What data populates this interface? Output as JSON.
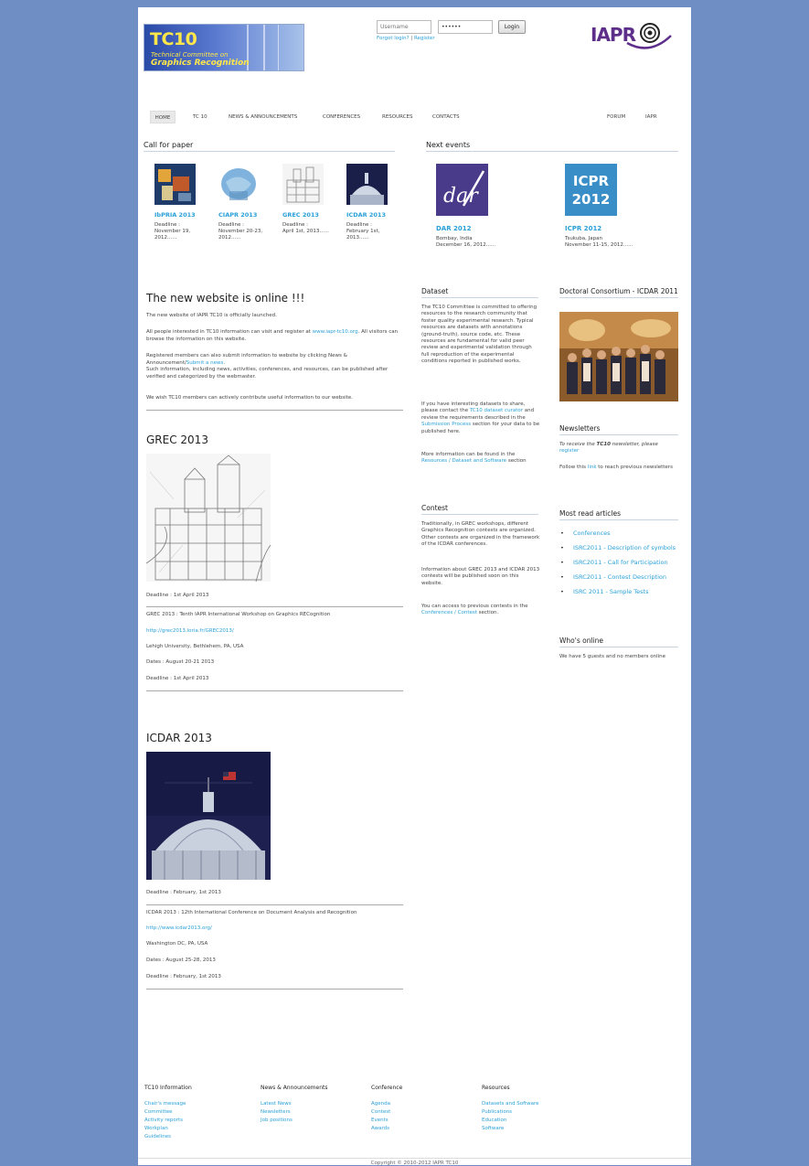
{
  "header": {
    "logo_big": "TC10",
    "logo_small1": "Technical Committee on",
    "logo_small2": "Graphics Recognition",
    "username_placeholder": "Username",
    "password_value": "••••••",
    "login_label": "Login",
    "forgot_label": "Forgot login?",
    "sep": "|",
    "register_label": "Register",
    "iapr_label": "IAPR"
  },
  "nav": {
    "items": [
      "HOME",
      "TC 10",
      "NEWS & ANNOUNCEMENTS",
      "CONFERENCES",
      "RESOURCES",
      "CONTACTS"
    ],
    "right": [
      "FORUM",
      "IAPR"
    ]
  },
  "call_for_paper": {
    "heading": "Call for paper",
    "items": [
      {
        "title": "IbPRIA 2013",
        "deadline": "Deadline :\nNovember 19,\n2012......"
      },
      {
        "title": "CIAPR 2013",
        "deadline": "Deadline :\nNovember 20-23,\n2012......"
      },
      {
        "title": "GREC 2013",
        "deadline": "Deadline :\nApril 1st, 2013......"
      },
      {
        "title": "ICDAR 2013",
        "deadline": "Deadline :\nFebruary 1st,\n2013......"
      }
    ]
  },
  "next_events": {
    "heading": "Next events",
    "items": [
      {
        "logo_text": "dar",
        "title": "DAR 2012",
        "loc": "Bombay, India",
        "date": "December 16, 2012......"
      },
      {
        "logo_text1": "ICPR",
        "logo_text2": "2012",
        "title": "ICPR 2012",
        "loc": "Tsukuba, Japan",
        "date": "November 11-15, 2012......"
      }
    ]
  },
  "main": {
    "news_title": "The new website is online !!!",
    "news_p1": "The new website of IAPR TC10 is officially launched.",
    "news_p2a": "All people interested in TC10 information can visit and register at ",
    "news_p2_link": "www.iapr-tc10.org",
    "news_p2b": ". All visitors can browse the information on this website.",
    "news_p3a": "Registered members can also submit information to website by clicking News & Announcement/",
    "news_p3_link": "Submit a news",
    "news_p3b": ".",
    "news_p4": "Such information, including news, activities, conferences, and resources,  can be published after verified and categorized by the webmaster.",
    "news_p5": "We wish TC10 members can actively contribute useful information to our website.",
    "grec_title": "GREC 2013",
    "grec_deadline": "Deadline : 1st April 2013",
    "grec_desc": "GREC 2013 : Tenth IAPR International Workshop on Graphics RECognition",
    "grec_url": "http://grec2013.loria.fr/GREC2013/",
    "grec_loc": "Lehigh University, Bethlehem, PA, USA",
    "grec_dates": "Dates : August 20-21 2013",
    "grec_deadline2": "Deadline : 1st April 2013",
    "icdar_title": "ICDAR 2013",
    "icdar_deadline": "Deadline : February, 1st 2013",
    "icdar_desc": "ICDAR 2013 : 12th International Conference on Document Analysis and Recognition",
    "icdar_url": "http://www.icdar2013.org/",
    "icdar_loc": "Washington DC, PA, USA",
    "icdar_dates": "Dates : August 25-28, 2013",
    "icdar_deadline2": "Deadline : February, 1st 2013"
  },
  "dataset": {
    "heading": "Dataset",
    "p1": "The TC10 Committee is committed to offering resources to the research community that foster quality experimental research. Typical resources are datasets with annotations (ground-truth), source code, etc. These resources are fundamental for valid peer review and experimental validation through full reproduction of the experimental conditions reported in published works.",
    "p2a": "If you have interesting datasets to share, please contact the ",
    "p2_link1": "TC10 dataset curator",
    "p2b": " and review the requirements described in the ",
    "p2_link2": "Submission Process",
    "p2c": " section for your data to be published here.",
    "p3a": "More information can be found in the ",
    "p3_link": "Resources / Dataset and Software",
    "p3b": " section"
  },
  "contest": {
    "heading": "Contest",
    "p1": "Traditionally, in GREC workshops, different Graphics Recognition contests are organized. Other contests are organized in the framework of the ICDAR conferences.",
    "p2": "Information about GREC 2013 and ICDAR 2013 contests will be published soon on this website.",
    "p3a": "You can access to previous contests in the ",
    "p3_link": "Conferences / Contest",
    "p3b": "  section."
  },
  "right": {
    "dc_heading": "Doctoral Consortium - ICDAR 2011",
    "newsletters_heading": "Newsletters",
    "nl_p1a": "To receive the ",
    "nl_p1b": "TC10",
    "nl_p1c": " newsletter, please ",
    "nl_p1_link": "register",
    "nl_p2a": "Follow this ",
    "nl_p2_link": "link",
    "nl_p2b": " to reach previous newsletters",
    "mra_heading": "Most read articles",
    "mra_items": [
      "Conferences",
      "ISRC2011 - Description of symbols",
      "ISRC2011 - Call for Participation",
      "ISRC2011 - Contest Description",
      "ISRC 2011 - Sample Tests"
    ],
    "online_heading": "Who's online",
    "online_text": "We have 5 guests and no members online"
  },
  "footer": {
    "cols": [
      {
        "heading": "TC10 Information",
        "links": [
          "Chair's message",
          "Committee",
          "Activity reports",
          "Workplan",
          "Guidelines"
        ]
      },
      {
        "heading": "News & Announcements",
        "links": [
          "Latest News",
          "Newsletters",
          "Job positions"
        ]
      },
      {
        "heading": "Conference",
        "links": [
          "Agenda",
          "Contest",
          "Events",
          "Awards"
        ]
      },
      {
        "heading": "Resources",
        "links": [
          "Datasets and Software",
          "Publications",
          "Education",
          "Software"
        ]
      }
    ],
    "copyright": "Copyright © 2010-2012 IAPR TC10"
  },
  "colors": {
    "background": "#6f8fc4",
    "link": "#2aa0d8",
    "iapr": "#5d2e8a",
    "logo_text": "#ffe74a"
  }
}
